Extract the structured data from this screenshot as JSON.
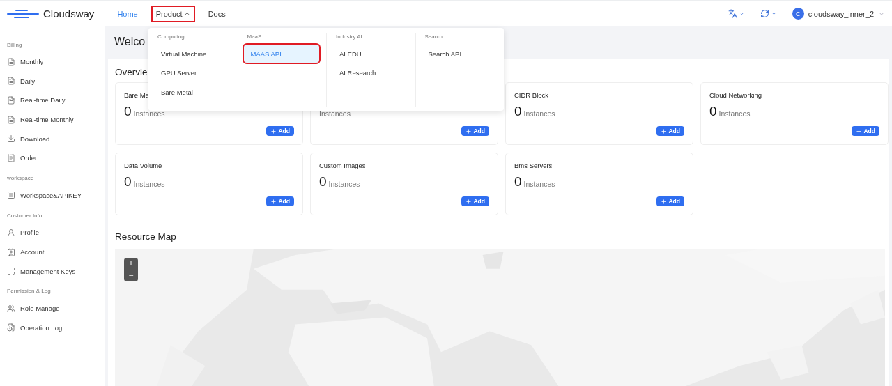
{
  "header": {
    "brand": "Cloudsway",
    "nav": [
      {
        "label": "Home",
        "selected": true,
        "highlighted": false
      },
      {
        "label": "Product",
        "selected": false,
        "highlighted": true,
        "expanded": true
      },
      {
        "label": "Docs",
        "selected": false,
        "highlighted": false
      }
    ],
    "user": {
      "avatar": "C",
      "name": "cloudsway_inner_2"
    }
  },
  "product_menu": {
    "columns": [
      {
        "heading": "Computing",
        "items": [
          {
            "label": "Virtual Machine",
            "selected": false,
            "highlighted": false
          },
          {
            "label": "GPU Server",
            "selected": false,
            "highlighted": false
          },
          {
            "label": "Bare Metal",
            "selected": false,
            "highlighted": false
          }
        ]
      },
      {
        "heading": "MaaS",
        "items": [
          {
            "label": "MAAS API",
            "selected": true,
            "highlighted": true
          }
        ]
      },
      {
        "heading": "Industry AI",
        "items": [
          {
            "label": "AI EDU",
            "selected": false,
            "highlighted": false
          },
          {
            "label": "AI Research",
            "selected": false,
            "highlighted": false
          }
        ]
      },
      {
        "heading": "Search",
        "items": [
          {
            "label": "Search API",
            "selected": false,
            "highlighted": false
          }
        ]
      }
    ]
  },
  "sidebar": {
    "groups": [
      {
        "heading": "Billing",
        "items": [
          {
            "label": "Monthly"
          },
          {
            "label": "Daily"
          },
          {
            "label": "Real-time Daily"
          },
          {
            "label": "Real-time Monthly"
          },
          {
            "label": "Download"
          },
          {
            "label": "Order"
          }
        ]
      },
      {
        "heading": "workspace",
        "items": [
          {
            "label": "Workspace&APIKEY"
          }
        ]
      },
      {
        "heading": "Customer Info",
        "items": [
          {
            "label": "Profile"
          },
          {
            "label": "Account"
          },
          {
            "label": "Management Keys"
          }
        ]
      },
      {
        "heading": "Permission & Log",
        "items": [
          {
            "label": "Role Manage"
          },
          {
            "label": "Operation Log"
          }
        ]
      }
    ]
  },
  "main": {
    "welcome": "Welco",
    "overview": {
      "title": "Overvie",
      "cards": [
        {
          "title": "Bare Me",
          "count": "0",
          "unit": "Instances",
          "button": "Add"
        },
        {
          "unit": "Instances",
          "button": "Add"
        },
        {
          "title": "CIDR Block",
          "count": "0",
          "unit": "Instances",
          "button": "Add"
        },
        {
          "title": "Cloud Networking",
          "count": "0",
          "unit": "Instances",
          "button": "Add"
        },
        {
          "title": "Data Volume",
          "count": "0",
          "unit": "Instances",
          "button": "Add"
        },
        {
          "title": "Custom Images",
          "count": "0",
          "unit": "Instances",
          "button": "Add"
        },
        {
          "title": "Bms Servers",
          "count": "0",
          "unit": "Instances",
          "button": "Add"
        }
      ]
    },
    "resource_map": {
      "title": "Resource Map",
      "zoom_in": "+",
      "zoom_out": "−"
    }
  }
}
